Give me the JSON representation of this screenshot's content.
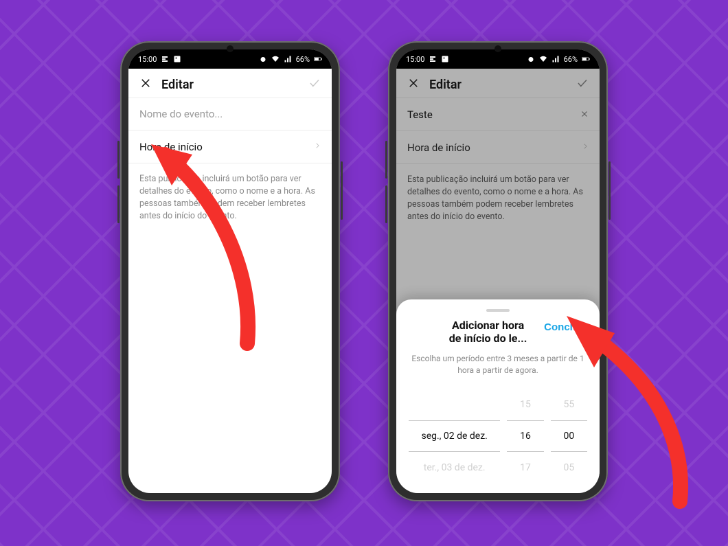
{
  "statusbar": {
    "time": "15:00",
    "battery": "66%"
  },
  "phone1": {
    "header": {
      "title": "Editar"
    },
    "event_name_placeholder": "Nome do evento...",
    "start_time_label": "Hora de início",
    "description": "Esta publicação incluirá um botão para ver detalhes do evento, como o nome e a hora. As pessoas também podem receber lembretes antes do início do evento."
  },
  "phone2": {
    "header": {
      "title": "Editar"
    },
    "event_name_value": "Teste",
    "start_time_label": "Hora de início",
    "description": "Esta publicação incluirá um botão para ver detalhes do evento, como o nome e a hora. As pessoas também podem receber lembretes antes do início do evento.",
    "sheet": {
      "title_line1": "Adicionar hora",
      "title_line2": "de início do le...",
      "done_label": "Concluir",
      "subtitle": "Escolha um período entre 3 meses a partir de 1 hora a partir de agora.",
      "picker": {
        "date_prev": "",
        "date_sel": "seg., 02 de dez.",
        "date_next": "ter., 03 de dez.",
        "hour_prev": "15",
        "hour_sel": "16",
        "hour_next": "17",
        "min_prev": "55",
        "min_sel": "00",
        "min_next": "05"
      }
    }
  },
  "colors": {
    "accent": "#1aa6e6",
    "arrow": "#f4302b",
    "bg": "#7e32c9"
  }
}
